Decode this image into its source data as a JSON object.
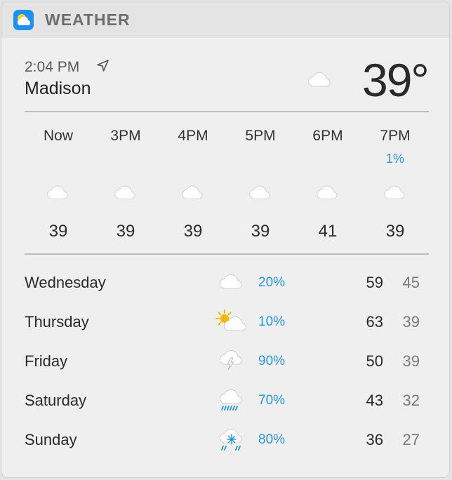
{
  "app": {
    "title": "WEATHER",
    "icon": "weather-app-icon"
  },
  "current": {
    "time": "2:04 PM",
    "city": "Madison",
    "temp": "39°",
    "icon": "cloud-icon"
  },
  "hourly": [
    {
      "label": "Now",
      "precip": "",
      "temp": "39",
      "icon": "cloud-icon"
    },
    {
      "label": "3PM",
      "precip": "",
      "temp": "39",
      "icon": "cloud-icon"
    },
    {
      "label": "4PM",
      "precip": "",
      "temp": "39",
      "icon": "cloud-icon"
    },
    {
      "label": "5PM",
      "precip": "",
      "temp": "39",
      "icon": "cloud-icon"
    },
    {
      "label": "6PM",
      "precip": "",
      "temp": "41",
      "icon": "cloud-icon"
    },
    {
      "label": "7PM",
      "precip": "1%",
      "temp": "39",
      "icon": "cloud-icon"
    }
  ],
  "daily": [
    {
      "day": "Wednesday",
      "precip": "20%",
      "hi": "59",
      "lo": "45",
      "icon": "cloud-icon"
    },
    {
      "day": "Thursday",
      "precip": "10%",
      "hi": "63",
      "lo": "39",
      "icon": "partly-sunny-icon"
    },
    {
      "day": "Friday",
      "precip": "90%",
      "hi": "50",
      "lo": "39",
      "icon": "thunderstorm-icon"
    },
    {
      "day": "Saturday",
      "precip": "70%",
      "hi": "43",
      "lo": "32",
      "icon": "rain-icon"
    },
    {
      "day": "Sunday",
      "precip": "80%",
      "hi": "36",
      "lo": "27",
      "icon": "snow-rain-icon"
    }
  ],
  "colors": {
    "accent": "#2a95d9",
    "background": "#efefef",
    "header": "#e4e4e4"
  }
}
